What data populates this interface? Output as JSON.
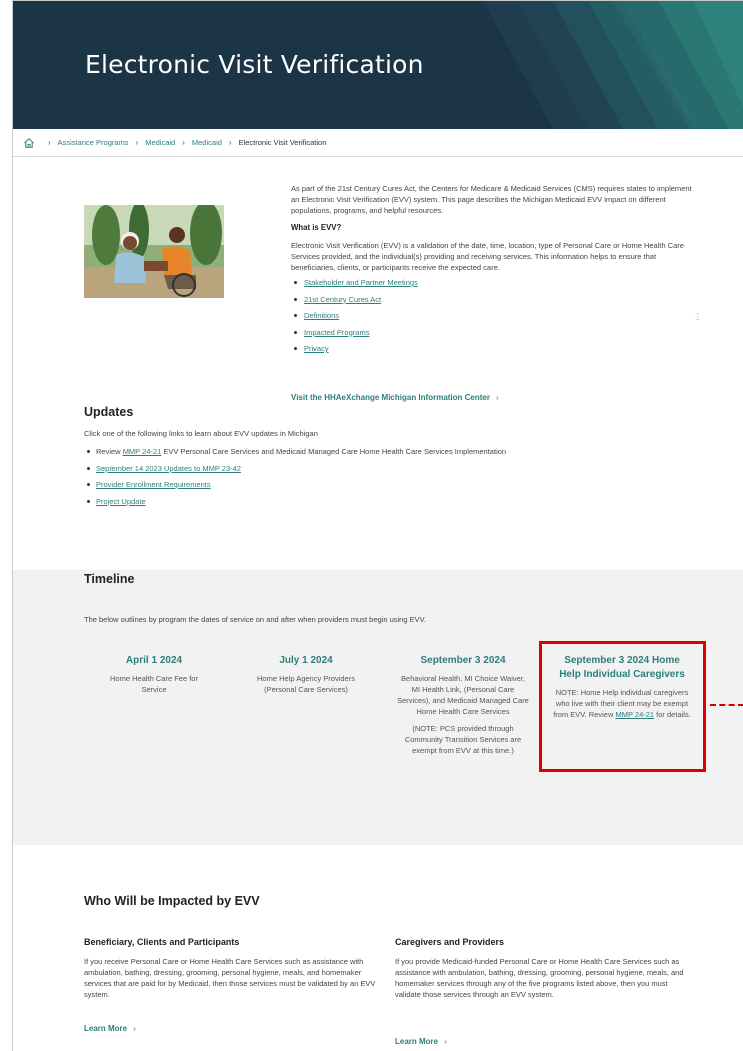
{
  "page": {
    "title": "Electronic Visit Verification"
  },
  "breadcrumb": {
    "items": [
      "Assistance Programs",
      "Medicaid",
      "Medicaid"
    ],
    "current": "Electronic Visit Verification"
  },
  "intro": {
    "paragraph": "As part of the 21st Century Cures Act, the Centers for Medicare & Medicaid Services (CMS) requires states to implement an Electronic Visit Verification (EVV) system. This page describes the Michigan Medicaid EVV impact on different populations, programs, and helpful resources.",
    "what_heading": "What is EVV?",
    "what_text": "Electronic Visit Verification (EVV) is a validation of the date, time, location, type of Personal Care or Home Health Care Services provided, and the individual(s) providing and receiving services. This information helps to ensure that beneficiaries, clients, or participants receive the expected care.",
    "links": [
      "Stakeholder and Partner Meetings",
      "21st Century Cures Act",
      "Definitions",
      "Impacted Programs",
      "Privacy"
    ],
    "visit_link": "Visit the HHAeXchange Michigan Information Center"
  },
  "updates": {
    "heading": "Updates",
    "intro": "Click one of the following links to learn about EVV updates in Michigan",
    "item1_prefix": "Review ",
    "item1_link": "MMP 24-21",
    "item1_suffix": " EVV Personal Care Services and Medicaid Managed Care Home Health Care Services Implementation",
    "links": [
      "September 14 2023 Updates to MMP 23-42",
      "Provider Enrollment Requirements",
      "Project Update"
    ]
  },
  "timeline": {
    "heading": "Timeline",
    "description": "The below outlines by program the dates of service on and after when providers must begin using EVV.",
    "col1": {
      "date": "April 1 2024",
      "text": "Home Health Care Fee for Service"
    },
    "col2": {
      "date": "July 1 2024",
      "text": "Home Help Agency Providers (Personal Care Services)"
    },
    "col3": {
      "date": "September 3 2024",
      "text": "Behavioral Health, MI Choice Waiver, MI Health Link, (Personal Care Services), and Medicaid Managed Care Home Health Care Services",
      "note": "(NOTE: PCS provided through Community Transition Services are exempt from EVV at this time.)"
    },
    "col4": {
      "date": "September 3 2024 Home Help Individual Caregivers",
      "note_prefix": "NOTE: Home Help individual caregivers who live with their client may be exempt from EVV. Review ",
      "note_link": "MMP 24-21",
      "note_suffix": " for details."
    }
  },
  "impacted": {
    "heading": "Who Will be Impacted by EVV",
    "left": {
      "title": "Beneficiary, Clients and Participants",
      "text": "If you receive Personal Care or Home Health Care Services such as assistance with ambulation, bathing, dressing, grooming, personal hygiene, meals, and homemaker services that are paid for by Medicaid, then those services must be validated by an EVV system.",
      "learn": "Learn More"
    },
    "right": {
      "title": "Caregivers and Providers",
      "text": "If you provide Medicaid-funded Personal Care or Home Health Care Services such as assistance with ambulation, bathing, dressing, grooming, personal hygiene, meals, and homemaker services through any of the five programs listed above, then you must validate those services through an EVV system.",
      "learn": "Learn More"
    }
  },
  "colors": {
    "hero_bg": "#1b3546",
    "teal": "#2d7e7a",
    "highlight": "#e00000"
  },
  "icons": {
    "home": "home-icon",
    "chevron": "chevron-right-icon"
  }
}
